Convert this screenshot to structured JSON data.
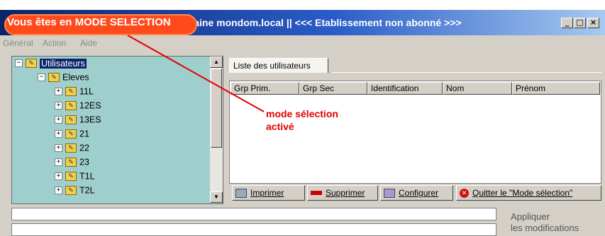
{
  "window": {
    "title": "e domaine mondom.local || <<< Etablissement non abonné >>>",
    "controls": [
      "_",
      "□",
      "×"
    ]
  },
  "mode_badge": "Vous êtes en MODE SELECTION",
  "menu": [
    "Général",
    "Action",
    "Aide"
  ],
  "tree": {
    "root": "Utilisateurs",
    "group": "Eleves",
    "classes": [
      "11L",
      "12ES",
      "13ES",
      "21",
      "22",
      "23",
      "T1L",
      "T2L"
    ]
  },
  "tab_label": "Liste des utilisateurs",
  "columns": [
    "Grp Prim.",
    "Grp Sec",
    "Identification",
    "Nom",
    "Prénom"
  ],
  "buttons": {
    "print": "Imprimer",
    "delete": "Supprimer",
    "configure": "Configurer",
    "quit": "Quitter le \"Mode sélection\""
  },
  "annotation": [
    "mode sélection",
    "activé"
  ],
  "apply": [
    "Appliquer",
    "les modifications"
  ],
  "colors": {
    "accent": "#ff4a1c",
    "annotation": "#e00000",
    "tree_bg": "#9fcfcd"
  }
}
